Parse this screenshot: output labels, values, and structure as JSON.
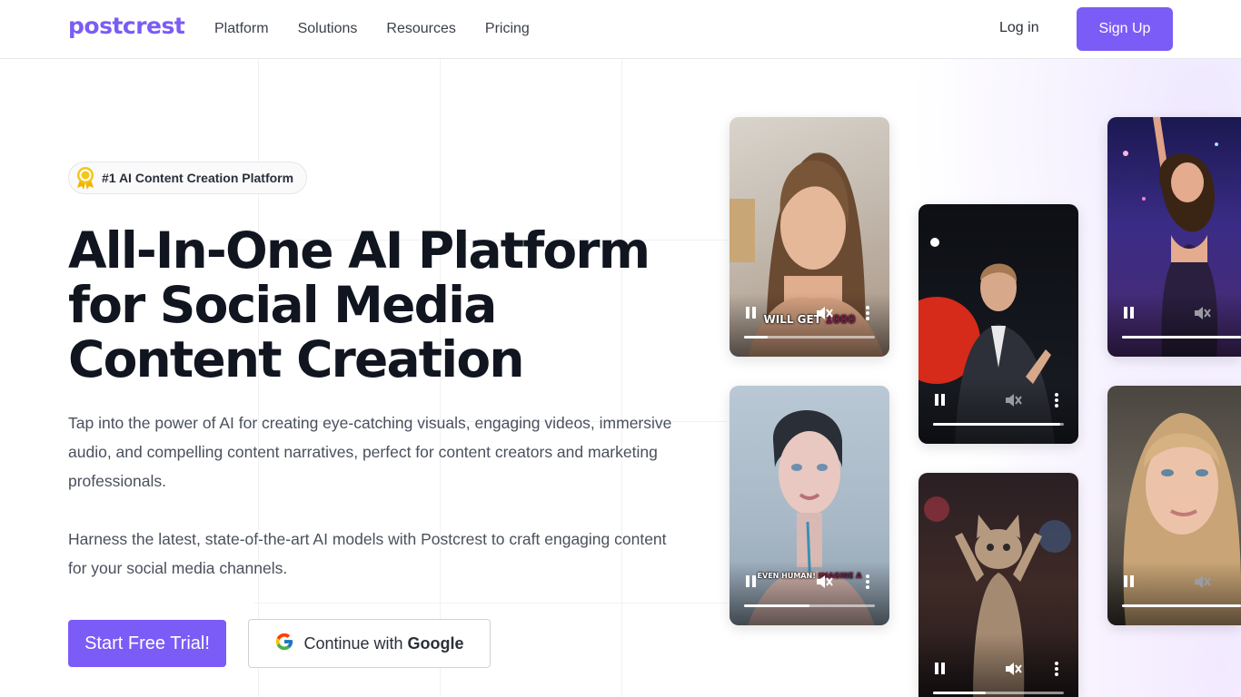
{
  "header": {
    "logo": "postcrest",
    "nav": [
      {
        "label": "Platform"
      },
      {
        "label": "Solutions"
      },
      {
        "label": "Resources"
      },
      {
        "label": "Pricing"
      }
    ],
    "login_label": "Log in",
    "signup_label": "Sign Up"
  },
  "hero": {
    "badge": "#1 AI Content Creation Platform",
    "title_lines": [
      "All-In-One AI Platform",
      "for Social Media",
      "Content Creation"
    ],
    "description_1": "Tap into the power of AI for creating eye-catching visuals, engaging videos, immersive audio, and compelling content narratives, perfect for content creators and marketing professionals.",
    "description_2": "Harness the latest, state-of-the-art AI models with Postcrest to craft engaging content for your social media channels.",
    "trial_label": "Start Free Trial!",
    "google_label_prefix": "Continue with",
    "google_label_brand": "Google"
  },
  "videos": [
    {
      "name": "video-woman-talking",
      "caption_plain": "WILL GET ",
      "caption_highlight": "1000",
      "progress": 0.18
    },
    {
      "name": "video-speaker-stage",
      "caption_plain": "",
      "caption_highlight": "",
      "progress": 0.97
    },
    {
      "name": "video-club-dancer",
      "caption_plain": "",
      "caption_highlight": "",
      "progress": 1.0
    },
    {
      "name": "video-ai-android",
      "caption_plain": "EVEN HUMAN! ",
      "caption_highlight": "IMAGINE A",
      "progress": 0.5
    },
    {
      "name": "video-dancing-cat",
      "caption_plain": "",
      "caption_highlight": "",
      "progress": 0.4
    },
    {
      "name": "video-blonde-woman",
      "caption_plain": "",
      "caption_highlight": "",
      "progress": 1.0
    }
  ],
  "colors": {
    "brand": "#7b5cf6",
    "title": "#111520",
    "text": "#4a505c"
  }
}
